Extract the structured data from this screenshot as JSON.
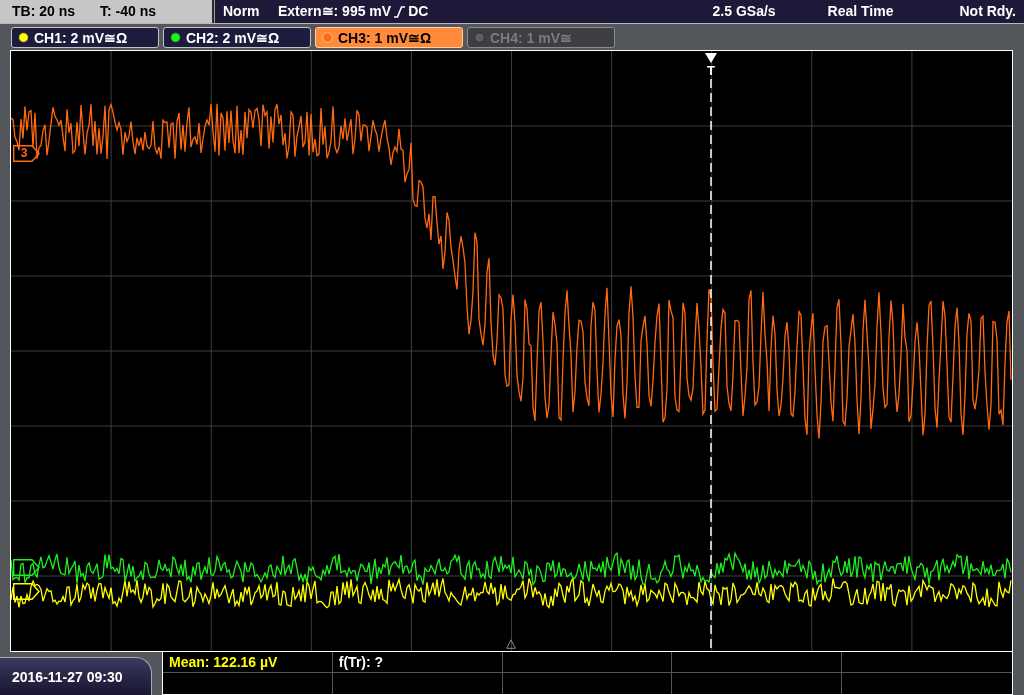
{
  "timebase": {
    "scale": "TB: 20 ns",
    "offset": "T: -40 ns"
  },
  "trigger": {
    "mode": "Norm",
    "source": "Extern≅: 995 mV",
    "coupling": "DC",
    "label": "T"
  },
  "acquisition": {
    "sample_rate": "2.5 GSa/s",
    "mode": "Real Time",
    "status": "Not Rdy."
  },
  "channels": [
    {
      "label": "CH1: 2 mV≅Ω",
      "color": "#ffff00",
      "on": true,
      "selected": false
    },
    {
      "label": "CH2: 2 mV≅Ω",
      "color": "#1ef01e",
      "on": true,
      "selected": false
    },
    {
      "label": "CH3: 1 mV≅Ω",
      "color": "#ff6a10",
      "on": true,
      "selected": true,
      "marker_label": "3"
    },
    {
      "label": "CH4: 1 mV≅",
      "on": false,
      "selected": false
    }
  ],
  "measurements": [
    {
      "text": "Mean: 122.16 µV",
      "color": "#ffff00"
    },
    {
      "text": "f(Tr): ?",
      "color": "#ffffff"
    }
  ],
  "date_time": "2016-11-27 09:30"
}
